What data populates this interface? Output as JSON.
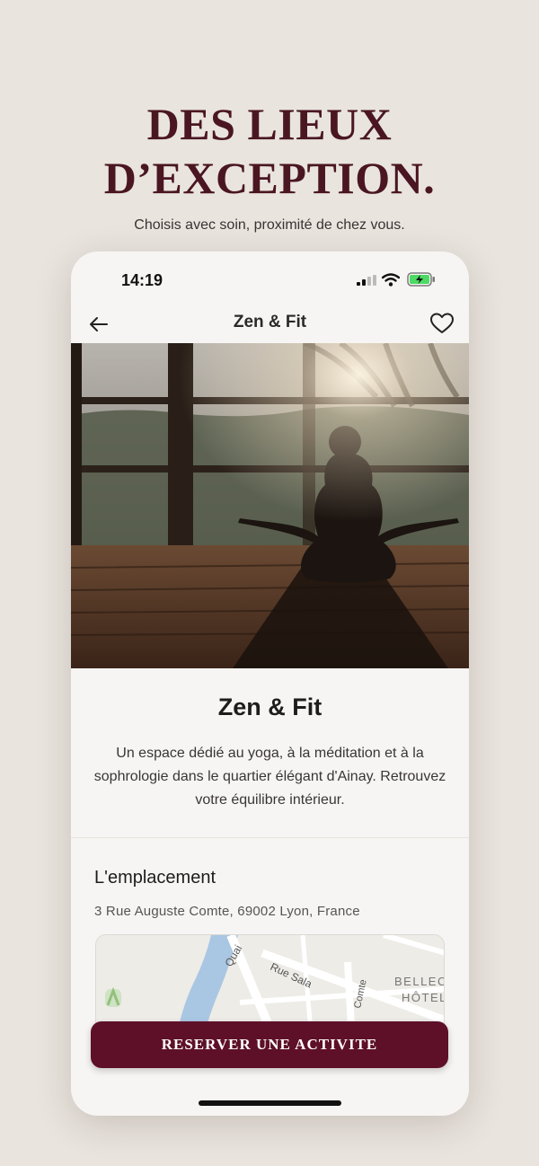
{
  "promo": {
    "headline_line1": "DES LIEUX",
    "headline_line2": "D’EXCEPTION.",
    "subtitle": "Choisis avec soin, proximité de chez vous."
  },
  "status_bar": {
    "time": "14:19"
  },
  "nav": {
    "title": "Zen & Fit"
  },
  "venue": {
    "name": "Zen & Fit",
    "description": "Un espace dédié au yoga, à la méditation et à la sophrologie dans le quartier élégant d'Ainay. Retrouvez votre équilibre intérieur."
  },
  "location": {
    "heading": "L'emplacement",
    "address": "3 Rue Auguste Comte, 69002 Lyon, France",
    "map_labels": {
      "street_quai": "Quai",
      "street_sala": "Rue Sala",
      "street_comte": "Comte",
      "poi_line1": "BELLEC",
      "poi_line2": "HÔTEL"
    }
  },
  "cta": {
    "reserve_label": "RESERVER UNE ACTIVITE"
  },
  "colors": {
    "brand": "#5e1029",
    "headline": "#4a1622",
    "background": "#e9e4de"
  }
}
